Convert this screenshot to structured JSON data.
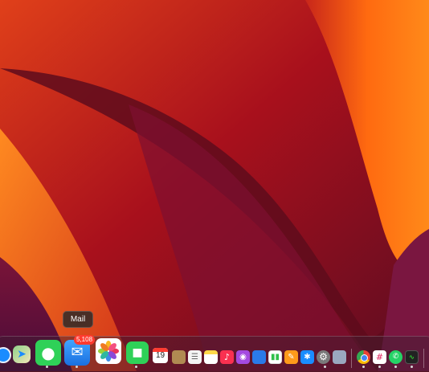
{
  "tooltip": {
    "label": "Mail"
  },
  "mail": {
    "badge": "5,108"
  },
  "calendar": {
    "day": "19"
  },
  "dock": {
    "icons": [
      "safari-icon",
      "maps-icon",
      "messages-icon",
      "mail-icon",
      "photos-icon",
      "facetime-icon",
      "calendar-icon",
      "contacts-icon",
      "reminders-icon",
      "notes-icon",
      "music-icon",
      "podcasts-icon",
      "keynote-icon",
      "numbers-icon",
      "pages-icon",
      "app-store-icon",
      "system-settings-icon",
      "preview-icon",
      "chrome-icon",
      "slack-icon",
      "whatsapp-icon",
      "activity-monitor-icon"
    ]
  },
  "colors": {
    "badge": "#ff3b30",
    "mail": "#1a8cff",
    "messages": "#2fd158",
    "facetime": "#2fd158"
  }
}
